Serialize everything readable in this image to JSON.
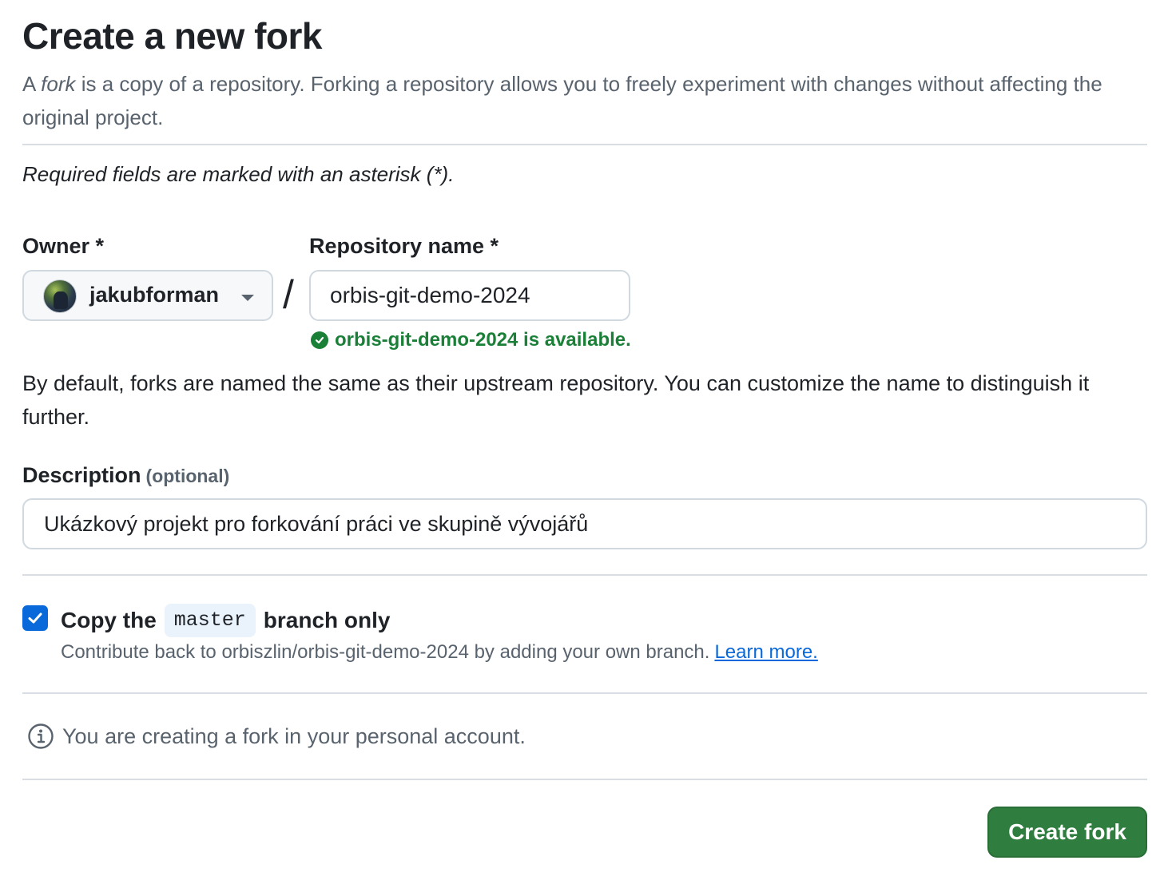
{
  "page": {
    "title": "Create a new fork",
    "subtitle_prefix": "A ",
    "subtitle_em": "fork",
    "subtitle_rest": " is a copy of a repository. Forking a repository allows you to freely experiment with changes without affecting the original project.",
    "required_note": "Required fields are marked with an asterisk (*)."
  },
  "form": {
    "owner": {
      "label": "Owner *",
      "value": "jakubforman"
    },
    "separator": "/",
    "repository": {
      "label": "Repository name *",
      "value": "orbis-git-demo-2024",
      "availability": "orbis-git-demo-2024 is available."
    },
    "helper_text": "By default, forks are named the same as their upstream repository. You can customize the name to distinguish it further.",
    "description": {
      "label": "Description",
      "optional": "(optional)",
      "value": "Ukázkový projekt pro forkování práci ve skupině vývojářů"
    },
    "copy_branch": {
      "checked": true,
      "label_before": "Copy the",
      "branch": "master",
      "label_after": "branch only",
      "help_text": "Contribute back to orbiszlin/orbis-git-demo-2024 by adding your own branch.",
      "learn_more": "Learn more."
    },
    "notice": "You are creating a fork in your personal account.",
    "submit_label": "Create fork"
  },
  "colors": {
    "success": "#1a7f37",
    "accent": "#0969da",
    "primary_button": "#2f7d3f",
    "muted_text": "#59636e"
  }
}
